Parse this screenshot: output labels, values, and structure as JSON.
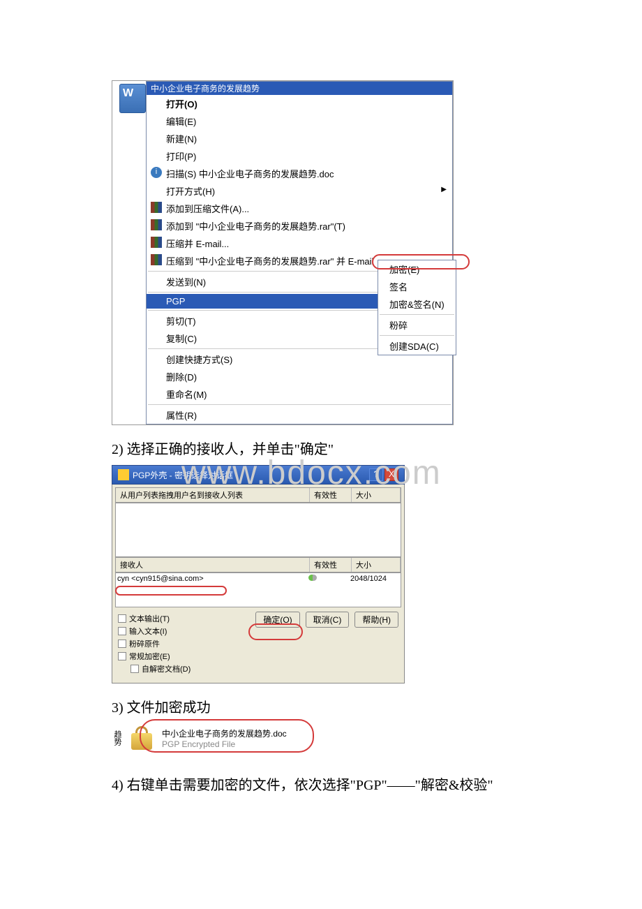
{
  "watermark": "www.bdocx.com",
  "fig1": {
    "filename_highlight": "中小企业电子商务的发展趋势",
    "items": [
      {
        "label": "打开(O)",
        "bold": true
      },
      {
        "label": "编辑(E)"
      },
      {
        "label": "新建(N)"
      },
      {
        "label": "打印(P)"
      },
      {
        "label": "扫描(S) 中小企业电子商务的发展趋势.doc",
        "icon": "blue"
      },
      {
        "label": "打开方式(H)",
        "arrow": true
      },
      {
        "label": "添加到压缩文件(A)...",
        "icon": "books"
      },
      {
        "label": "添加到 \"中小企业电子商务的发展趋势.rar\"(T)",
        "icon": "books"
      },
      {
        "label": "压缩并 E-mail...",
        "icon": "books"
      },
      {
        "label": "压缩到 \"中小企业电子商务的发展趋势.rar\" 并 E-mail",
        "icon": "books"
      },
      {
        "sep": true
      },
      {
        "label": "发送到(N)",
        "arrow": true
      },
      {
        "sep": true
      },
      {
        "label": "PGP",
        "arrow": true,
        "highlighted": true
      },
      {
        "sep": true
      },
      {
        "label": "剪切(T)"
      },
      {
        "label": "复制(C)"
      },
      {
        "sep": true
      },
      {
        "label": "创建快捷方式(S)"
      },
      {
        "label": "删除(D)"
      },
      {
        "label": "重命名(M)"
      },
      {
        "sep": true
      },
      {
        "label": "属性(R)"
      }
    ],
    "submenu": [
      {
        "label": "加密(E)"
      },
      {
        "label": "签名"
      },
      {
        "label": "加密&签名(N)"
      },
      {
        "sep": true
      },
      {
        "label": "粉碎"
      },
      {
        "sep": true
      },
      {
        "label": "创建SDA(C)"
      }
    ]
  },
  "text2": "2) 选择正确的接收人，并单击\"确定\"",
  "fig2": {
    "title": "PGP外壳 - 密钥选择对话框",
    "hdr1": {
      "name": "从用户列表拖拽用户名到接收人列表",
      "valid": "有效性",
      "size": "大小"
    },
    "hdr2": {
      "name": "接收人",
      "valid": "有效性",
      "size": "大小"
    },
    "recipient": {
      "name": "cyn <cyn915@sina.com>",
      "size": "2048/1024"
    },
    "checks": {
      "text_out": "文本输出(T)",
      "input_text": "输入文本(I)",
      "shred": "粉碎原件",
      "conv": "常规加密(E)",
      "self": "自解密文档(D)"
    },
    "buttons": {
      "ok": "确定(O)",
      "cancel": "取消(C)",
      "help": "帮助(H)"
    }
  },
  "text3": "3) 文件加密成功",
  "fig3": {
    "side": "趋势",
    "filename": "中小企业电子商务的发展趋势.doc",
    "filetype": "PGP Encrypted File"
  },
  "text4": "4) 右键单击需要加密的文件，依次选择\"PGP\"——\"解密&校验\""
}
